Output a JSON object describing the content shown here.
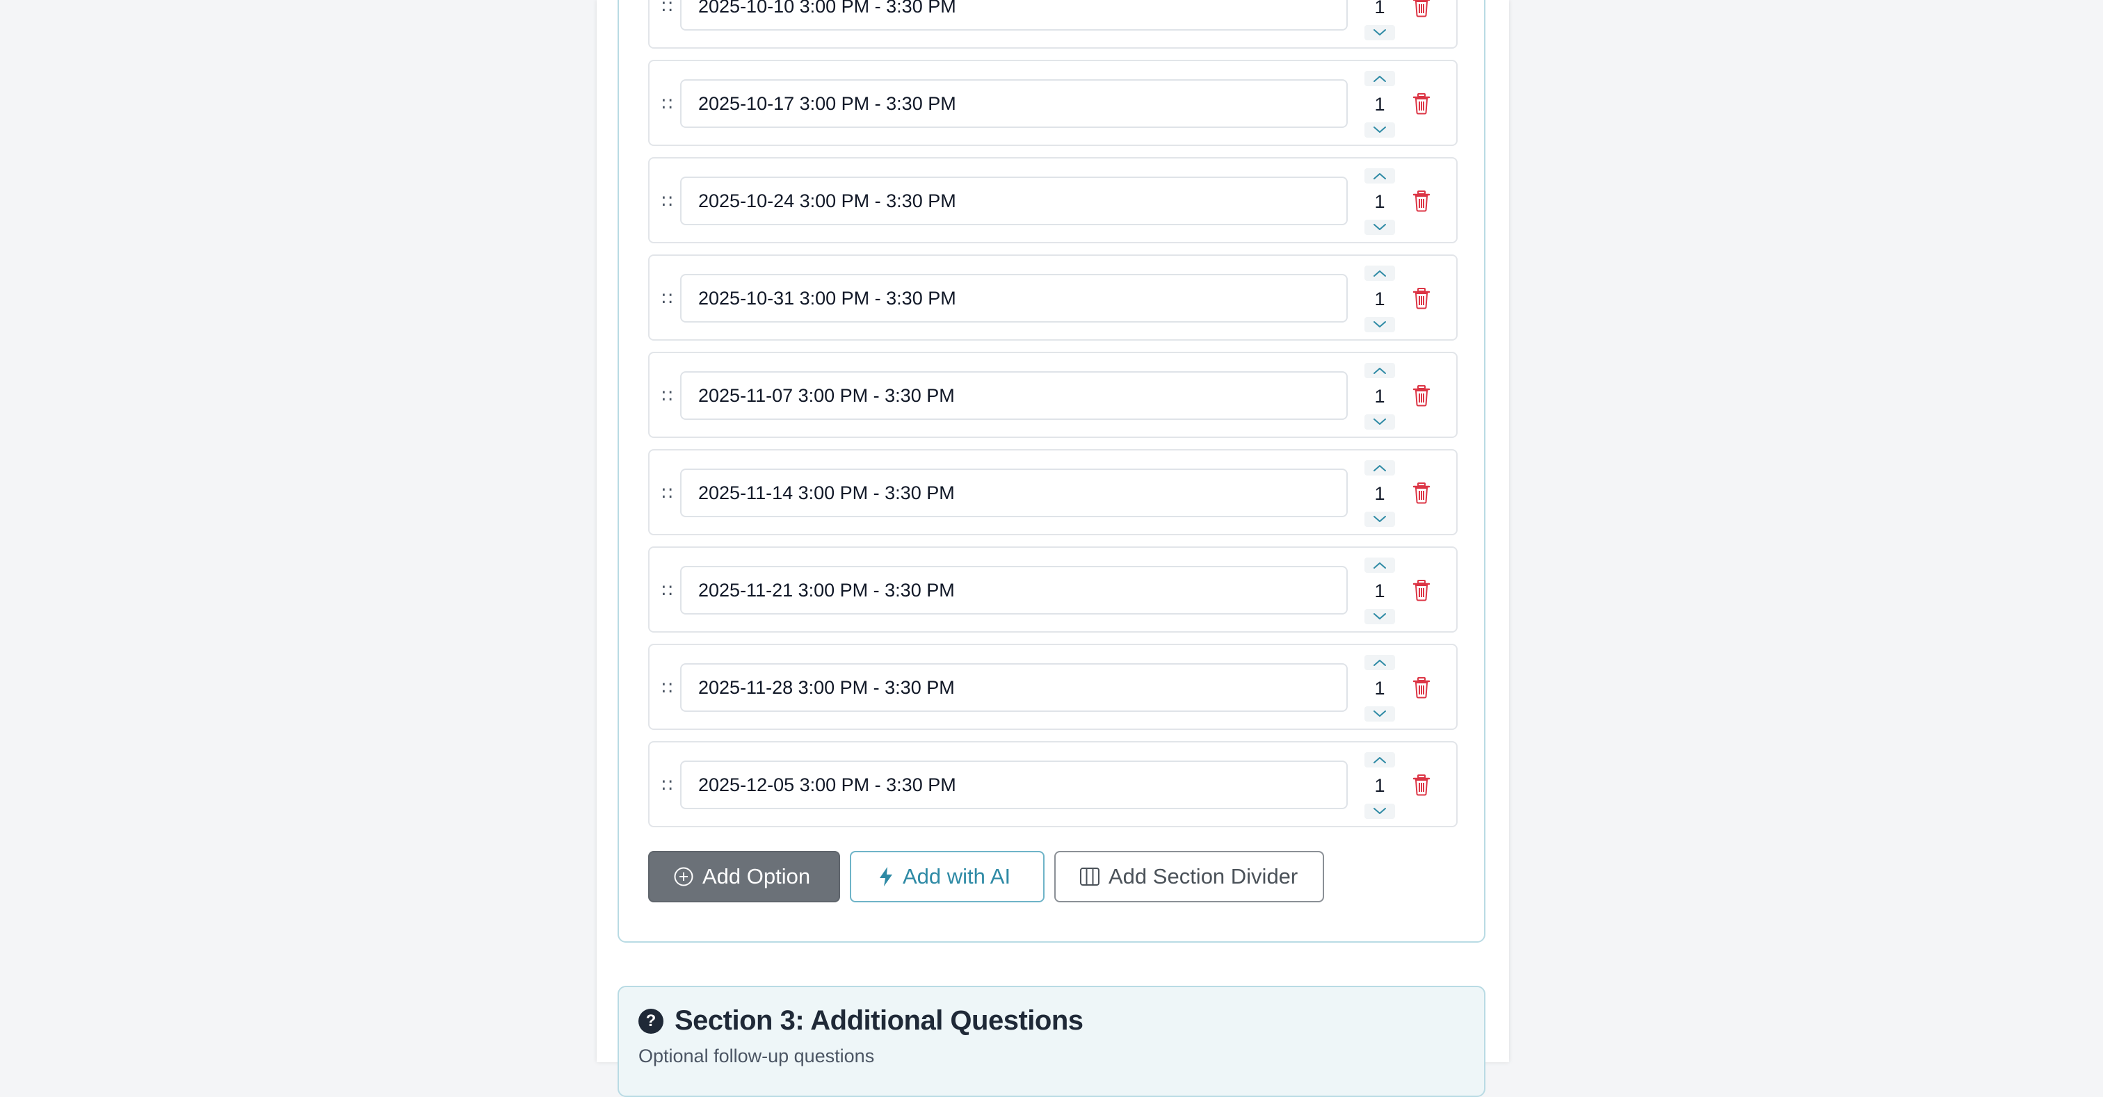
{
  "colors": {
    "accent": "#2e8aa5",
    "danger": "#dc3545",
    "card_border": "#b9dbe4",
    "primary_button": "#6b7178"
  },
  "options": [
    {
      "label": "2025-10-10 3:00 PM - 3:30 PM",
      "count": "1"
    },
    {
      "label": "2025-10-17 3:00 PM - 3:30 PM",
      "count": "1"
    },
    {
      "label": "2025-10-24 3:00 PM - 3:30 PM",
      "count": "1"
    },
    {
      "label": "2025-10-31 3:00 PM - 3:30 PM",
      "count": "1"
    },
    {
      "label": "2025-11-07 3:00 PM - 3:30 PM",
      "count": "1"
    },
    {
      "label": "2025-11-14 3:00 PM - 3:30 PM",
      "count": "1"
    },
    {
      "label": "2025-11-21 3:00 PM - 3:30 PM",
      "count": "1"
    },
    {
      "label": "2025-11-28 3:00 PM - 3:30 PM",
      "count": "1"
    },
    {
      "label": "2025-12-05 3:00 PM - 3:30 PM",
      "count": "1"
    }
  ],
  "drag_handle_glyph": "::",
  "icons": {
    "drag": "drag-handle-icon",
    "increment": "chevron-up-icon",
    "decrement": "chevron-down-icon",
    "delete": "trash-icon",
    "add_option": "plus-circle-icon",
    "add_ai": "lightning-icon",
    "add_divider": "columns-icon",
    "section_help": "question-circle-icon"
  },
  "actions": {
    "add_option_label": "Add Option",
    "add_ai_label": "Add with AI",
    "add_divider_label": "Add Section Divider"
  },
  "section3": {
    "icon_glyph": "?",
    "title": "Section 3: Additional Questions",
    "subtitle": "Optional follow-up questions"
  }
}
